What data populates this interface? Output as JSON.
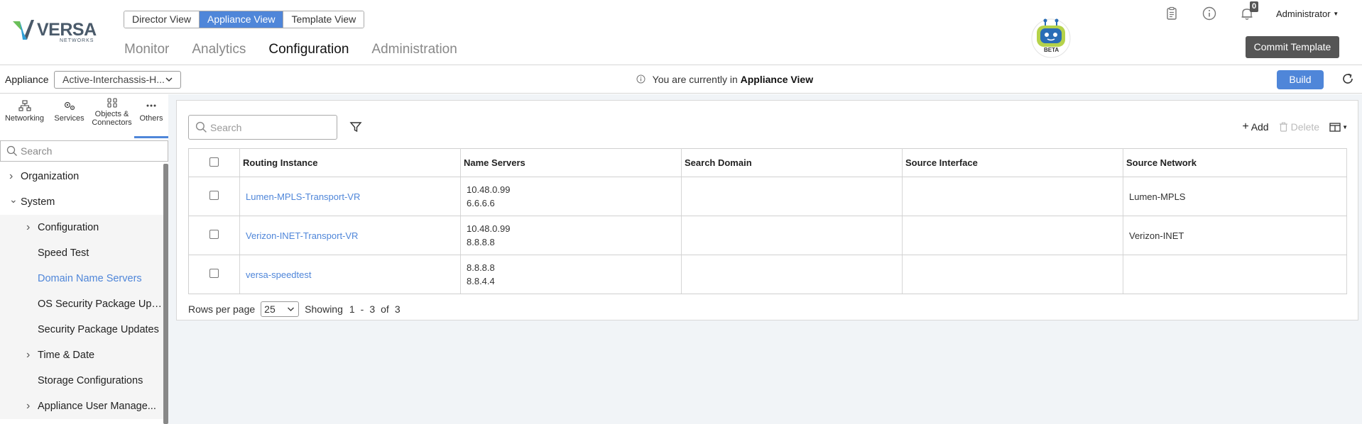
{
  "header": {
    "logo_text": "VERSA",
    "logo_sub": "NETWORKS",
    "views": [
      "Director View",
      "Appliance View",
      "Template View"
    ],
    "active_view": 1,
    "nav": [
      "Monitor",
      "Analytics",
      "Configuration",
      "Administration"
    ],
    "active_nav": 2,
    "bot_badge": "BETA",
    "notification_count": "0",
    "user": "Administrator",
    "commit_label": "Commit Template",
    "accent_color": "#4f86d9"
  },
  "subbar": {
    "appliance_label": "Appliance",
    "appliance_value": "Active-Interchassis-H...",
    "info_prefix": "You are currently in",
    "info_strong": "Appliance View",
    "build_label": "Build"
  },
  "sidebar": {
    "tabs": [
      "Networking",
      "Services",
      "Objects & Connectors",
      "Others"
    ],
    "active_tab": 3,
    "search_placeholder": "Search",
    "tree": [
      {
        "label": "Organization",
        "level": 0,
        "arrow": "right"
      },
      {
        "label": "System",
        "level": 0,
        "arrow": "down"
      },
      {
        "label": "Configuration",
        "level": 1,
        "arrow": "right"
      },
      {
        "label": "Speed Test",
        "level": 1,
        "arrow": ""
      },
      {
        "label": "Domain Name Servers",
        "level": 1,
        "arrow": "",
        "selected": true
      },
      {
        "label": "OS Security Package Upd...",
        "level": 1,
        "arrow": ""
      },
      {
        "label": "Security Package Updates",
        "level": 1,
        "arrow": ""
      },
      {
        "label": "Time & Date",
        "level": 1,
        "arrow": "right"
      },
      {
        "label": "Storage Configurations",
        "level": 1,
        "arrow": ""
      },
      {
        "label": "Appliance User Manage...",
        "level": 1,
        "arrow": "right"
      }
    ]
  },
  "table": {
    "search_placeholder": "Search",
    "add_label": "Add",
    "delete_label": "Delete",
    "columns": [
      "Routing Instance",
      "Name Servers",
      "Search Domain",
      "Source Interface",
      "Source Network"
    ],
    "rows": [
      {
        "routing_instance": "Lumen-MPLS-Transport-VR",
        "name_servers": [
          "10.48.0.99",
          "6.6.6.6"
        ],
        "search_domain": "",
        "source_interface": "",
        "source_network": "Lumen-MPLS"
      },
      {
        "routing_instance": "Verizon-INET-Transport-VR",
        "name_servers": [
          "10.48.0.99",
          "8.8.8.8"
        ],
        "search_domain": "",
        "source_interface": "",
        "source_network": "Verizon-INET"
      },
      {
        "routing_instance": "versa-speedtest",
        "name_servers": [
          "8.8.8.8",
          "8.8.4.4"
        ],
        "search_domain": "",
        "source_interface": "",
        "source_network": ""
      }
    ],
    "pager": {
      "rows_per_page_label": "Rows per page",
      "rows_per_page": "25",
      "showing_label": "Showing",
      "from": "1",
      "dash": "-",
      "to": "3",
      "of_label": "of",
      "total": "3"
    }
  }
}
